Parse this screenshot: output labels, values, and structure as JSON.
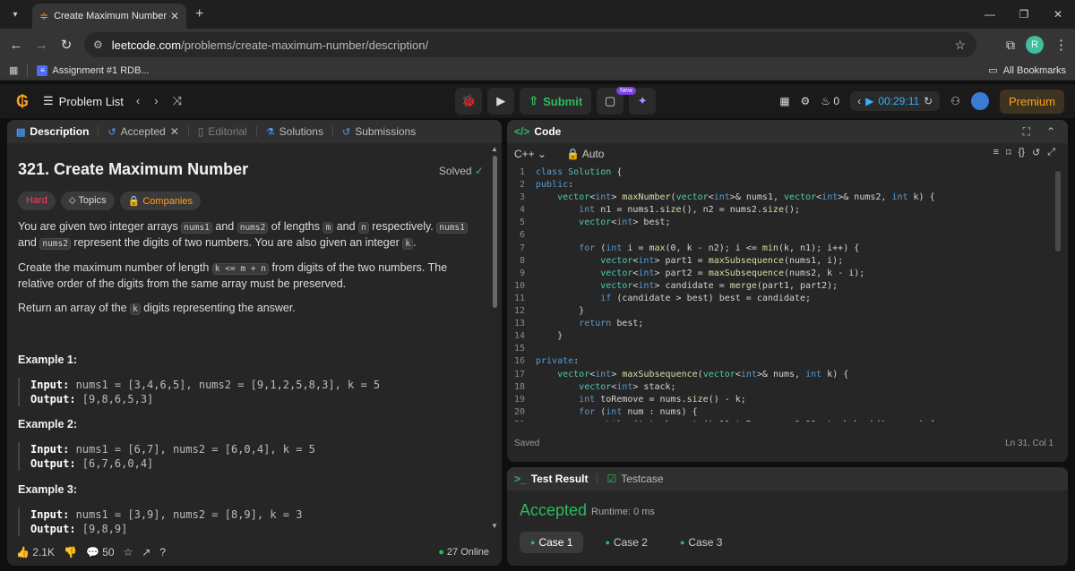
{
  "browser": {
    "tab_title": "Create Maximum Number - Lee",
    "new_tab": "+",
    "url_host": "leetcode.com",
    "url_path": "/problems/create-maximum-number/description/",
    "bookmark": "Assignment #1 RDB...",
    "all_bookmarks": "All Bookmarks",
    "profile_initial": "R"
  },
  "lc_nav": {
    "problem_list": "Problem List",
    "submit": "Submit",
    "new_badge": "New",
    "streak": "0",
    "timer": "00:29:11",
    "premium": "Premium"
  },
  "left_tabs": [
    "Description",
    "Accepted",
    "Editorial",
    "Solutions",
    "Submissions"
  ],
  "problem": {
    "title": "321. Create Maximum Number",
    "status": "Solved",
    "tags": [
      "Hard",
      "Topics",
      "Companies"
    ],
    "p1_a": "You are given two integer arrays ",
    "p1_c1": "nums1",
    "p1_b": " and ",
    "p1_c2": "nums2",
    "p1_d": " of lengths ",
    "p1_c3": "m",
    "p1_e": " and ",
    "p1_c4": "n",
    "p1_f": " respectively. ",
    "p1_c5": "nums1",
    "p1_g": " and ",
    "p1_c6": "nums2",
    "p1_h": " represent the digits of two numbers. You are also given an integer ",
    "p1_c7": "k",
    "p1_i": ".",
    "p2_a": "Create the maximum number of length ",
    "p2_c1": "k <= m + n",
    "p2_b": " from digits of the two numbers. The relative order of the digits from the same array must be preserved.",
    "p3_a": "Return an array of the ",
    "p3_c1": "k",
    "p3_b": " digits representing the answer.",
    "examples": [
      {
        "h": "Example 1:",
        "in_label": "Input:",
        "in": " nums1 = [3,4,6,5], nums2 = [9,1,2,5,8,3], k = 5",
        "out_label": "Output:",
        "out": " [9,8,6,5,3]"
      },
      {
        "h": "Example 2:",
        "in_label": "Input:",
        "in": " nums1 = [6,7], nums2 = [6,0,4], k = 5",
        "out_label": "Output:",
        "out": " [6,7,6,0,4]"
      },
      {
        "h": "Example 3:",
        "in_label": "Input:",
        "in": " nums1 = [3,9], nums2 = [8,9], k = 3",
        "out_label": "Output:",
        "out": " [9,8,9]"
      }
    ]
  },
  "left_footer": {
    "likes": "2.1K",
    "comments": "50",
    "online": "27 Online"
  },
  "editor": {
    "title": "Code",
    "language": "C++",
    "mode": "Auto",
    "saved": "Saved",
    "cursor": "Ln 31, Col 1"
  },
  "result": {
    "tab1": "Test Result",
    "tab2": "Testcase",
    "status": "Accepted",
    "runtime": "Runtime: 0 ms",
    "cases": [
      "Case 1",
      "Case 2",
      "Case 3"
    ]
  },
  "colors": {
    "accent_green": "#2cbb5d",
    "accent_orange": "#ffa116",
    "hard_red": "#ff375f",
    "link_blue": "#2db3ff"
  }
}
